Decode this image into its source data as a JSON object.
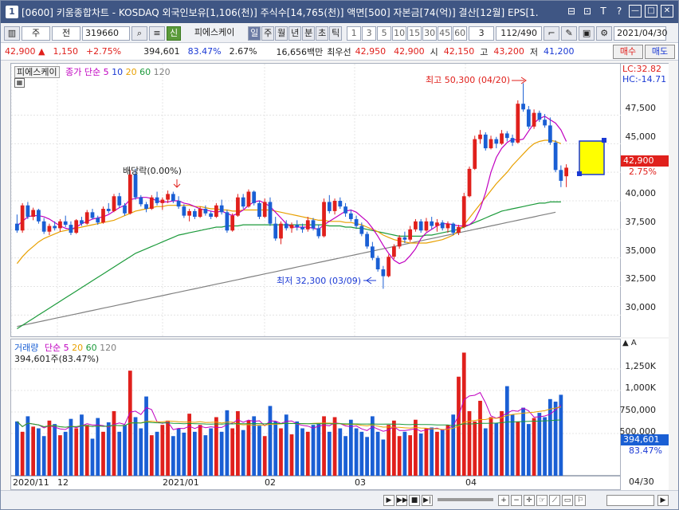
{
  "window": {
    "title": "[0600] 키움종합차트 - KOSDAQ 외국인보유[1,106(천)] 주식수[14,765(천)] 액면[500] 자본금[74(억)] 결산[12월] EPS[1.",
    "num": "1"
  },
  "titlebar_btns": [
    "⊟",
    "⊡",
    "T",
    "?",
    "—",
    "□",
    "✕"
  ],
  "toolbar": {
    "period": "주",
    "compare": "전",
    "code": "319660",
    "name": "피에스케이",
    "badge": "신",
    "tf": [
      "일",
      "주",
      "월",
      "년",
      "분",
      "초",
      "틱"
    ],
    "mins": [
      "1",
      "3",
      "5",
      "10",
      "15",
      "30",
      "45",
      "60"
    ],
    "count_sel": "3",
    "count": "112/490",
    "date": "2021/04/30"
  },
  "info": {
    "price": "42,900",
    "arrow": "▲",
    "change": "1,150",
    "rate": "+2.75%",
    "volume": "394,601",
    "vol_rate": "83.47%",
    "turnover": "2.67%",
    "amount": "16,656백만",
    "bid_lbl": "최우선",
    "bid1": "42,950",
    "bid2": "42,900",
    "open_lbl": "시",
    "open": "42,150",
    "high_lbl": "고",
    "high": "43,200",
    "low_lbl": "저",
    "low": "41,200",
    "buy": "매수",
    "sell": "매도"
  },
  "legend": {
    "name": "피에스케이",
    "ma_lbl": "종가 단순",
    "ma": [
      "5",
      "10",
      "20",
      "60",
      "120"
    ],
    "ma_colors": [
      "#c000c0",
      "#1a39d4",
      "#e8a000",
      "#1b9a3a",
      "#808080"
    ]
  },
  "vol_legend": {
    "lbl": "거래량",
    "ma_lbl": "단순",
    "ma": [
      "5",
      "20",
      "60",
      "120"
    ],
    "value": "394,601주(83.47%)"
  },
  "annot": {
    "high": "최고 50,300 (04/20)",
    "low": "최저 32,300 (03/09)",
    "div": "배당락(0.00%)"
  },
  "yaxis": {
    "lc": "LC:32.82",
    "hc": "HC:-14.71",
    "ticks": [
      "47,500",
      "45,000",
      "42,900",
      "2.75%",
      "40,000",
      "37,500",
      "35,000",
      "32,500",
      "30,000"
    ]
  },
  "vaxis": {
    "ticks": [
      "1,250K",
      "1,000K",
      "750,000",
      "500,000",
      "394,601",
      "83.47%"
    ]
  },
  "xaxis": {
    "labels": [
      "2020/11",
      "12",
      "2021/01",
      "02",
      "03",
      "04"
    ],
    "end": "04/30"
  },
  "chart_data": {
    "type": "candlestick",
    "ylim": [
      28000,
      52000
    ],
    "candles": [
      [
        38000,
        38800,
        37200,
        37400
      ],
      [
        37400,
        39800,
        37200,
        39600
      ],
      [
        39600,
        39900,
        38400,
        38600
      ],
      [
        38600,
        39400,
        38300,
        39200
      ],
      [
        39200,
        39300,
        38000,
        38200
      ],
      [
        38200,
        38500,
        37100,
        37300
      ],
      [
        37300,
        38000,
        37000,
        37800
      ],
      [
        37800,
        38200,
        37400,
        37600
      ],
      [
        37600,
        38400,
        37300,
        38200
      ],
      [
        38200,
        38700,
        37700,
        37900
      ],
      [
        37900,
        38200,
        37000,
        37200
      ],
      [
        37200,
        38400,
        37100,
        38300
      ],
      [
        38300,
        38600,
        37800,
        38000
      ],
      [
        38000,
        39200,
        37900,
        39000
      ],
      [
        39000,
        39300,
        38400,
        38500
      ],
      [
        38500,
        38700,
        37900,
        38100
      ],
      [
        38100,
        39500,
        38000,
        39300
      ],
      [
        39300,
        39800,
        38900,
        39100
      ],
      [
        39100,
        40600,
        39000,
        40400
      ],
      [
        40400,
        40700,
        39400,
        39600
      ],
      [
        39600,
        39800,
        38700,
        38900
      ],
      [
        38900,
        42700,
        38800,
        42300
      ],
      [
        42300,
        42800,
        40100,
        40300
      ],
      [
        40300,
        40500,
        39500,
        39700
      ],
      [
        39700,
        39900,
        39000,
        39300
      ],
      [
        39300,
        40500,
        39200,
        40300
      ],
      [
        40300,
        40800,
        39600,
        39800
      ],
      [
        39800,
        40300,
        39200,
        40100
      ],
      [
        40100,
        40900,
        39800,
        40600
      ],
      [
        40600,
        40800,
        39800,
        40000
      ],
      [
        40000,
        40400,
        39300,
        39500
      ],
      [
        39500,
        39700,
        38500,
        38700
      ],
      [
        38700,
        39300,
        38200,
        39100
      ],
      [
        39100,
        39300,
        38400,
        38600
      ],
      [
        38600,
        39500,
        38500,
        39300
      ],
      [
        39300,
        39600,
        38700,
        38900
      ],
      [
        38900,
        39100,
        38400,
        38600
      ],
      [
        38600,
        39800,
        38500,
        39600
      ],
      [
        39600,
        40100,
        38800,
        39000
      ],
      [
        39000,
        39200,
        37200,
        37400
      ],
      [
        37400,
        38900,
        37300,
        38700
      ],
      [
        38700,
        40600,
        38600,
        40300
      ],
      [
        40300,
        40600,
        39300,
        39500
      ],
      [
        39500,
        41000,
        39400,
        40800
      ],
      [
        40800,
        40900,
        39600,
        39800
      ],
      [
        39800,
        40000,
        38400,
        38600
      ],
      [
        38600,
        40200,
        38500,
        39900
      ],
      [
        39900,
        40300,
        37800,
        38000
      ],
      [
        38000,
        38600,
        36500,
        36700
      ],
      [
        36700,
        38200,
        36200,
        38000
      ],
      [
        38000,
        38300,
        37400,
        37600
      ],
      [
        37600,
        38100,
        37200,
        37900
      ],
      [
        37900,
        38300,
        37400,
        37700
      ],
      [
        37700,
        38000,
        37200,
        37500
      ],
      [
        37500,
        38600,
        37300,
        38300
      ],
      [
        38300,
        38500,
        37400,
        37600
      ],
      [
        37600,
        37900,
        36700,
        36900
      ],
      [
        36900,
        40200,
        36800,
        39900
      ],
      [
        39900,
        40500,
        38900,
        39100
      ],
      [
        39100,
        40200,
        38800,
        40000
      ],
      [
        40000,
        40300,
        39300,
        39500
      ],
      [
        39500,
        39800,
        38600,
        38900
      ],
      [
        38900,
        39200,
        38200,
        38400
      ],
      [
        38400,
        38700,
        37600,
        37800
      ],
      [
        37800,
        38100,
        36900,
        37100
      ],
      [
        37100,
        37300,
        35800,
        36000
      ],
      [
        36000,
        36400,
        34800,
        35000
      ],
      [
        35000,
        35200,
        33800,
        34000
      ],
      [
        34000,
        34300,
        32300,
        33400
      ],
      [
        33400,
        35300,
        33300,
        35100
      ],
      [
        35100,
        36200,
        34900,
        36000
      ],
      [
        36000,
        37000,
        35800,
        36800
      ],
      [
        36800,
        37300,
        36300,
        36600
      ],
      [
        36600,
        37800,
        36400,
        37500
      ],
      [
        37500,
        38400,
        37300,
        38200
      ],
      [
        38200,
        38400,
        37200,
        37400
      ],
      [
        37400,
        38500,
        37300,
        38200
      ],
      [
        38200,
        38600,
        37500,
        37800
      ],
      [
        37800,
        38400,
        37300,
        38100
      ],
      [
        38100,
        38300,
        37400,
        37600
      ],
      [
        37600,
        38200,
        37200,
        38000
      ],
      [
        38000,
        38100,
        37000,
        37200
      ],
      [
        37200,
        37900,
        37000,
        37700
      ],
      [
        37700,
        40700,
        37600,
        40400
      ],
      [
        40400,
        43000,
        40300,
        42800
      ],
      [
        42800,
        45700,
        42700,
        45400
      ],
      [
        45400,
        46200,
        45000,
        45800
      ],
      [
        45800,
        46000,
        44400,
        44600
      ],
      [
        44600,
        45700,
        44500,
        45400
      ],
      [
        45400,
        45600,
        44600,
        45000
      ],
      [
        45000,
        46200,
        44900,
        45900
      ],
      [
        45900,
        46100,
        45200,
        45500
      ],
      [
        45500,
        45800,
        44800,
        45100
      ],
      [
        45100,
        48800,
        45000,
        48500
      ],
      [
        48500,
        50300,
        47800,
        48000
      ],
      [
        48000,
        48300,
        46300,
        46500
      ],
      [
        46500,
        48000,
        46300,
        47700
      ],
      [
        47700,
        47900,
        46900,
        47100
      ],
      [
        47100,
        47600,
        46400,
        46600
      ],
      [
        46600,
        47300,
        44900,
        45100
      ],
      [
        45100,
        45300,
        42500,
        42700
      ],
      [
        42700,
        43100,
        41200,
        41750
      ],
      [
        42150,
        43200,
        41200,
        42900
      ]
    ],
    "volumes": [
      640,
      520,
      700,
      580,
      560,
      470,
      650,
      610,
      480,
      520,
      670,
      560,
      720,
      600,
      440,
      680,
      520,
      630,
      760,
      520,
      600,
      1230,
      690,
      560,
      930,
      480,
      520,
      600,
      650,
      470,
      560,
      510,
      730,
      520,
      600,
      480,
      560,
      690,
      520,
      770,
      560,
      760,
      540,
      650,
      700,
      590,
      470,
      820,
      640,
      560,
      720,
      490,
      640,
      560,
      520,
      600,
      610,
      700,
      520,
      690,
      560,
      470,
      660,
      560,
      520,
      460,
      700,
      520,
      430,
      600,
      650,
      470,
      520,
      480,
      660,
      500,
      560,
      570,
      520,
      540,
      600,
      720,
      1160,
      1440,
      760,
      640,
      880,
      560,
      690,
      620,
      760,
      1050,
      720,
      640,
      800,
      610,
      680,
      740,
      690,
      900,
      870,
      950
    ],
    "ma5": [
      37800,
      38200,
      38600,
      38700,
      38700,
      38600,
      38400,
      38100,
      37800,
      37600,
      37500,
      37700,
      38000,
      38200,
      38400,
      38500,
      38600,
      38800,
      39100,
      39400,
      39600,
      40100,
      40200,
      40300,
      40300,
      40200,
      40000,
      39900,
      39900,
      40000,
      40000,
      39800,
      39700,
      39500,
      39300,
      39200,
      39100,
      39000,
      39100,
      38900,
      38700,
      38900,
      39200,
      39600,
      39900,
      40000,
      39800,
      39500,
      39000,
      38500,
      38000,
      37700,
      37700,
      37700,
      37700,
      37600,
      37500,
      37900,
      38200,
      38500,
      38800,
      39100,
      39200,
      39000,
      38600,
      38200,
      37600,
      36900,
      36100,
      35400,
      34800,
      34500,
      34700,
      35200,
      35800,
      36700,
      37200,
      37500,
      37800,
      38000,
      38000,
      37900,
      37800,
      37800,
      37900,
      38300,
      39300,
      40700,
      42500,
      43800,
      44600,
      45100,
      45400,
      45300,
      45400,
      46100,
      46800,
      47200,
      47400,
      47100,
      46800,
      46200,
      45200,
      44100,
      43300,
      42600
    ],
    "ma20": [
      34500,
      35100,
      35600,
      36000,
      36400,
      36700,
      36900,
      37100,
      37300,
      37400,
      37500,
      37600,
      37700,
      37800,
      37900,
      38000,
      38100,
      38200,
      38300,
      38500,
      38700,
      38900,
      39100,
      39200,
      39300,
      39400,
      39500,
      39500,
      39600,
      39600,
      39600,
      39600,
      39600,
      39500,
      39500,
      39400,
      39300,
      39300,
      39200,
      39200,
      39100,
      39100,
      39200,
      39200,
      39200,
      39200,
      39200,
      39200,
      39100,
      39000,
      38900,
      38800,
      38700,
      38600,
      38500,
      38400,
      38300,
      38300,
      38200,
      38200,
      38200,
      38100,
      38100,
      38000,
      37900,
      37700,
      37500,
      37300,
      37000,
      36800,
      36600,
      36500,
      36400,
      36300,
      36300,
      36300,
      36300,
      36400,
      36500,
      36600,
      36800,
      37000,
      37400,
      37900,
      38500,
      39100,
      39700,
      40300,
      40900,
      41500,
      42000,
      42500,
      43100,
      43600,
      44100,
      44600,
      45000,
      45200,
      45300,
      45300,
      45200,
      45000
    ],
    "ma60": [
      28800,
      29100,
      29400,
      29700,
      30000,
      30300,
      30600,
      30900,
      31200,
      31500,
      31800,
      32100,
      32400,
      32700,
      33000,
      33300,
      33600,
      33900,
      34200,
      34500,
      34800,
      35100,
      35400,
      35600,
      35800,
      36000,
      36200,
      36400,
      36600,
      36800,
      37000,
      37100,
      37200,
      37300,
      37400,
      37500,
      37600,
      37700,
      37700,
      37800,
      37800,
      37800,
      37900,
      37900,
      37900,
      37900,
      37900,
      37900,
      37900,
      37900,
      37900,
      37900,
      37900,
      37900,
      37900,
      37900,
      37900,
      37900,
      37800,
      37800,
      37800,
      37700,
      37700,
      37600,
      37600,
      37500,
      37400,
      37300,
      37200,
      37100,
      37000,
      36900,
      36900,
      36900,
      36900,
      36900,
      37000,
      37000,
      37100,
      37200,
      37300,
      37400,
      37500,
      37700,
      37900,
      38100,
      38300,
      38500,
      38700,
      38900,
      39100,
      39200,
      39300,
      39400,
      39500,
      39600,
      39700,
      39800,
      39800,
      39900,
      39900,
      39900
    ],
    "ma120": [
      29000,
      29100,
      29200,
      29300,
      29400,
      29500,
      29600,
      29700,
      29800,
      29900,
      30000,
      30100,
      30200,
      30300,
      30400,
      30500,
      30600,
      30700,
      30800,
      30900,
      31000,
      31100,
      31200,
      31300,
      31400,
      31500,
      31600,
      31700,
      31800,
      31900,
      32000,
      32100,
      32200,
      32300,
      32400,
      32500,
      32600,
      32700,
      32800,
      32900,
      33000,
      33100,
      33200,
      33300,
      33400,
      33500,
      33600,
      33700,
      33800,
      33900,
      34000,
      34100,
      34200,
      34300,
      34400,
      34500,
      34600,
      34700,
      34800,
      34900,
      35000,
      35100,
      35200,
      35300,
      35400,
      35500,
      35600,
      35700,
      35800,
      35900,
      36000,
      36100,
      36200,
      36300,
      36400,
      36500,
      36600,
      36700,
      36800,
      36900,
      37000,
      37100,
      37200,
      37300,
      37400,
      37500,
      37600,
      37700,
      37800,
      37900,
      38000,
      38100,
      38200,
      38300,
      38400,
      38500,
      38600,
      38700,
      38800,
      38900,
      39000
    ]
  },
  "colors": {
    "up": "#e0201c",
    "down": "#1a5fd4",
    "accent": "#3f5684"
  }
}
